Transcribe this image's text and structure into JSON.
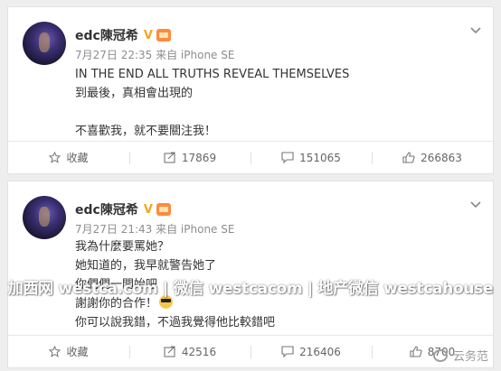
{
  "posts": [
    {
      "author": "edc陳冠希",
      "verified_badge": "V",
      "timestamp": "7月27日 22:35 来自 iPhone SE",
      "content": [
        "IN THE END ALL TRUTHS REVEAL THEMSELVES",
        "到最後，真相會出現的",
        "",
        "不喜歡我，就不要關注我！"
      ],
      "actions": {
        "favorite": "收藏",
        "repost": "17869",
        "comment": "151065",
        "like": "266863"
      }
    },
    {
      "author": "edc陳冠希",
      "verified_badge": "V",
      "timestamp": "7月27日 21:43 来自 iPhone SE",
      "content": [
        "我為什麼要罵她？",
        "她知道的，我早就警告她了",
        "你們們一開始吧",
        "謝謝你的合作！",
        "你可以說我錯，不過我覺得他比較錯吧"
      ],
      "actions": {
        "favorite": "收藏",
        "repost": "42516",
        "comment": "216406",
        "like": "8700"
      }
    }
  ],
  "watermark": "加西网 westca.com | 微信 westcacom | 地产微信 westcahouse",
  "corner_watermark": "云务范",
  "colors": {
    "background": "#eeeeee",
    "card": "#ffffff",
    "text": "#333333",
    "meta": "#8d8d8d",
    "verified": "#f5a623"
  }
}
